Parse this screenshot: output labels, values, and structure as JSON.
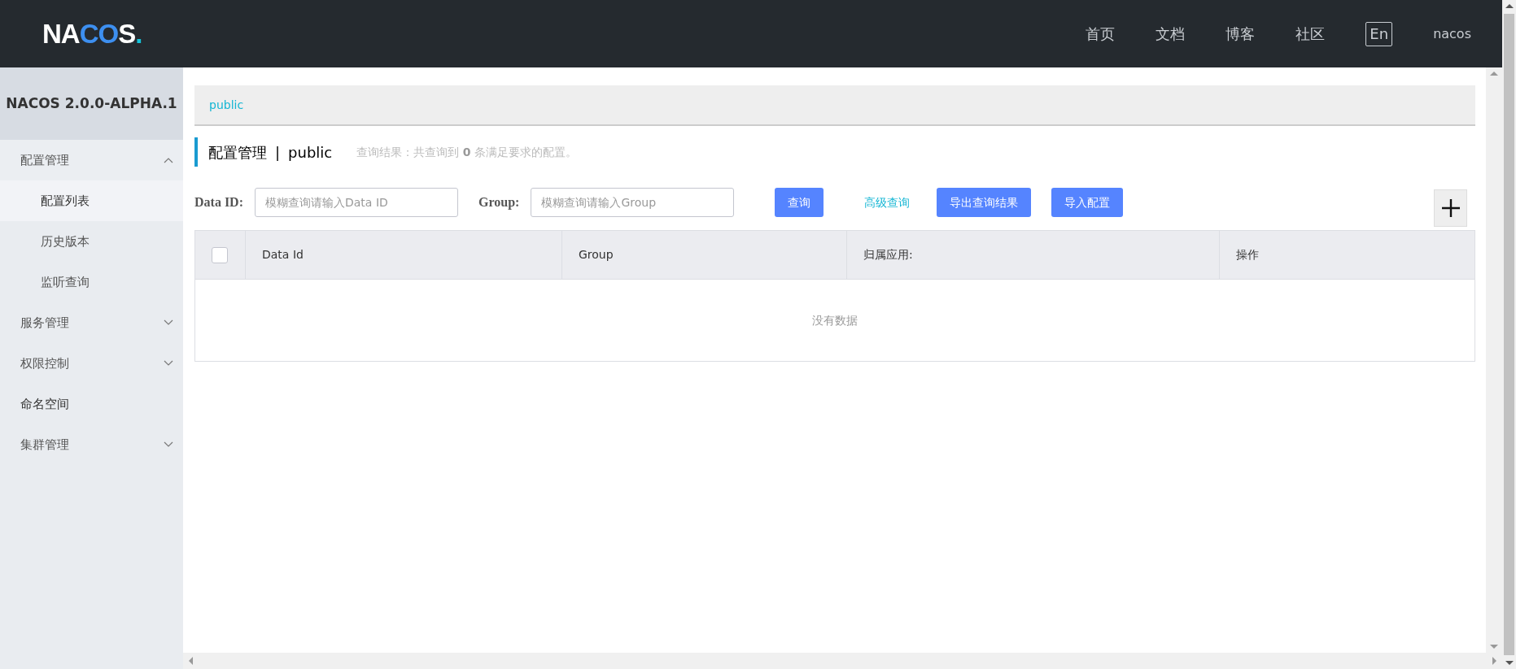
{
  "header": {
    "logo": "NACOS.",
    "nav": [
      "首页",
      "文档",
      "博客",
      "社区"
    ],
    "language": "En",
    "user": "nacos"
  },
  "sidebar": {
    "title": "NACOS 2.0.0-ALPHA.1",
    "items": [
      {
        "label": "配置管理",
        "kind": "group",
        "expanded": true,
        "children": [
          {
            "label": "配置列表",
            "selected": true
          },
          {
            "label": "历史版本",
            "selected": false
          },
          {
            "label": "监听查询",
            "selected": false
          }
        ]
      },
      {
        "label": "服务管理",
        "kind": "group",
        "expanded": false
      },
      {
        "label": "权限控制",
        "kind": "group",
        "expanded": false
      },
      {
        "label": "命名空间",
        "kind": "link"
      },
      {
        "label": "集群管理",
        "kind": "group",
        "expanded": false
      }
    ]
  },
  "breadcrumb": "public",
  "page": {
    "title": "配置管理",
    "separator": "|",
    "namespace": "public",
    "summary": "查询结果：共查询到 **0** 条满足要求的配置。"
  },
  "filters": [
    {
      "label": "Data ID:",
      "placeholder": "模糊查询请输入Data ID"
    },
    {
      "label": "Group:",
      "placeholder": "模糊查询请输入Group"
    }
  ],
  "actions": [
    {
      "label": "查询",
      "kind": "primary"
    },
    {
      "label": "高级查询",
      "kind": "link"
    },
    {
      "label": "导出查询结果",
      "kind": "primary"
    },
    {
      "label": "导入配置",
      "kind": "primary"
    }
  ],
  "table": {
    "select_all": {
      "checked": false
    },
    "columns": [
      "Data Id",
      "Group",
      "归属应用:",
      "操作"
    ],
    "empty": "没有数据"
  }
}
